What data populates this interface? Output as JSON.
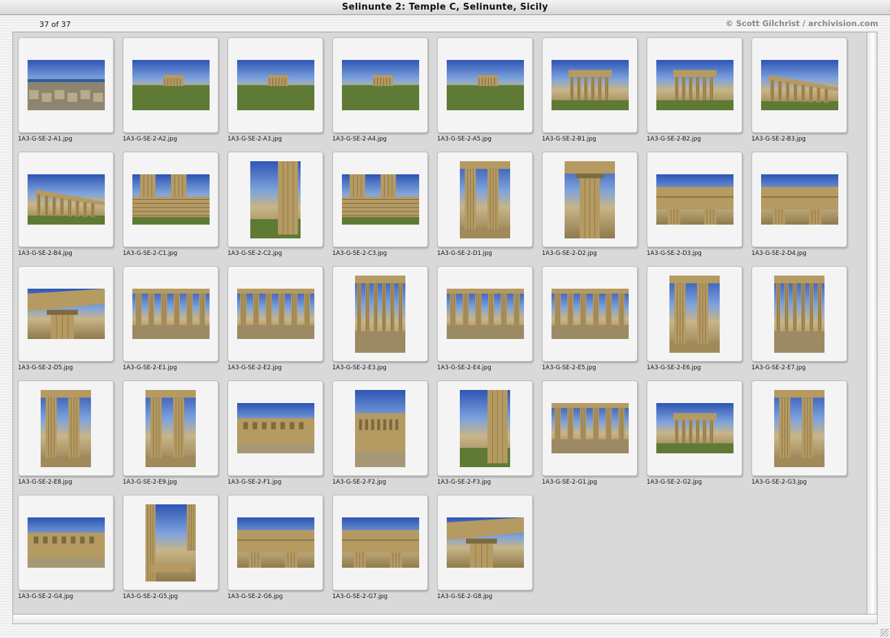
{
  "window": {
    "title": "Selinunte 2: Temple C, Selinunte, Sicily"
  },
  "header": {
    "count": "37 of 37",
    "credit": "© Scott Gilchrist / archivision.com"
  },
  "icons": {
    "resize": "resize-grip-icon"
  },
  "thumbnails": [
    {
      "file": "1A3-G-SE-2-A1.jpg",
      "orientation": "landscape",
      "scene": "coast-ruins"
    },
    {
      "file": "1A3-G-SE-2-A2.jpg",
      "orientation": "landscape",
      "scene": "distant-temple"
    },
    {
      "file": "1A3-G-SE-2-A3.jpg",
      "orientation": "landscape",
      "scene": "distant-temple"
    },
    {
      "file": "1A3-G-SE-2-A4.jpg",
      "orientation": "landscape",
      "scene": "distant-temple"
    },
    {
      "file": "1A3-G-SE-2-A5.jpg",
      "orientation": "landscape",
      "scene": "distant-temple"
    },
    {
      "file": "1A3-G-SE-2-B1.jpg",
      "orientation": "landscape",
      "scene": "temple-front"
    },
    {
      "file": "1A3-G-SE-2-B2.jpg",
      "orientation": "landscape",
      "scene": "temple-front"
    },
    {
      "file": "1A3-G-SE-2-B3.jpg",
      "orientation": "landscape",
      "scene": "temple-angle"
    },
    {
      "file": "1A3-G-SE-2-B4.jpg",
      "orientation": "landscape",
      "scene": "temple-angle"
    },
    {
      "file": "1A3-G-SE-2-C1.jpg",
      "orientation": "landscape",
      "scene": "stone-base"
    },
    {
      "file": "1A3-G-SE-2-C2.jpg",
      "orientation": "portrait",
      "scene": "column-corner"
    },
    {
      "file": "1A3-G-SE-2-C3.jpg",
      "orientation": "landscape",
      "scene": "stone-base"
    },
    {
      "file": "1A3-G-SE-2-D1.jpg",
      "orientation": "portrait",
      "scene": "columns-close"
    },
    {
      "file": "1A3-G-SE-2-D2.jpg",
      "orientation": "portrait",
      "scene": "single-column"
    },
    {
      "file": "1A3-G-SE-2-D3.jpg",
      "orientation": "landscape",
      "scene": "entablature"
    },
    {
      "file": "1A3-G-SE-2-D4.jpg",
      "orientation": "landscape",
      "scene": "entablature"
    },
    {
      "file": "1A3-G-SE-2-D5.jpg",
      "orientation": "landscape",
      "scene": "capital"
    },
    {
      "file": "1A3-G-SE-2-E1.jpg",
      "orientation": "landscape",
      "scene": "colonnade"
    },
    {
      "file": "1A3-G-SE-2-E2.jpg",
      "orientation": "landscape",
      "scene": "colonnade"
    },
    {
      "file": "1A3-G-SE-2-E3.jpg",
      "orientation": "portrait",
      "scene": "colonnade"
    },
    {
      "file": "1A3-G-SE-2-E4.jpg",
      "orientation": "landscape",
      "scene": "colonnade"
    },
    {
      "file": "1A3-G-SE-2-E5.jpg",
      "orientation": "landscape",
      "scene": "colonnade"
    },
    {
      "file": "1A3-G-SE-2-E6.jpg",
      "orientation": "portrait",
      "scene": "columns-close"
    },
    {
      "file": "1A3-G-SE-2-E7.jpg",
      "orientation": "portrait",
      "scene": "colonnade"
    },
    {
      "file": "1A3-G-SE-2-E8.jpg",
      "orientation": "portrait",
      "scene": "columns-close"
    },
    {
      "file": "1A3-G-SE-2-E9.jpg",
      "orientation": "portrait",
      "scene": "columns-close"
    },
    {
      "file": "1A3-G-SE-2-F1.jpg",
      "orientation": "landscape",
      "scene": "inner-wall"
    },
    {
      "file": "1A3-G-SE-2-F2.jpg",
      "orientation": "portrait",
      "scene": "inner-wall"
    },
    {
      "file": "1A3-G-SE-2-F3.jpg",
      "orientation": "portrait",
      "scene": "column-corner"
    },
    {
      "file": "1A3-G-SE-2-G1.jpg",
      "orientation": "landscape",
      "scene": "colonnade"
    },
    {
      "file": "1A3-G-SE-2-G2.jpg",
      "orientation": "landscape",
      "scene": "temple-front"
    },
    {
      "file": "1A3-G-SE-2-G3.jpg",
      "orientation": "portrait",
      "scene": "columns-close"
    },
    {
      "file": "1A3-G-SE-2-G4.jpg",
      "orientation": "landscape",
      "scene": "inner-wall"
    },
    {
      "file": "1A3-G-SE-2-G5.jpg",
      "orientation": "portrait",
      "scene": "looking-up"
    },
    {
      "file": "1A3-G-SE-2-G6.jpg",
      "orientation": "landscape",
      "scene": "entablature"
    },
    {
      "file": "1A3-G-SE-2-G7.jpg",
      "orientation": "landscape",
      "scene": "entablature"
    },
    {
      "file": "1A3-G-SE-2-G8.jpg",
      "orientation": "landscape",
      "scene": "capital"
    }
  ],
  "colors": {
    "sky": "#2d55b4",
    "stone": "#b59a62",
    "grass": "#5f7a35",
    "panel": "#d9d9d9"
  }
}
